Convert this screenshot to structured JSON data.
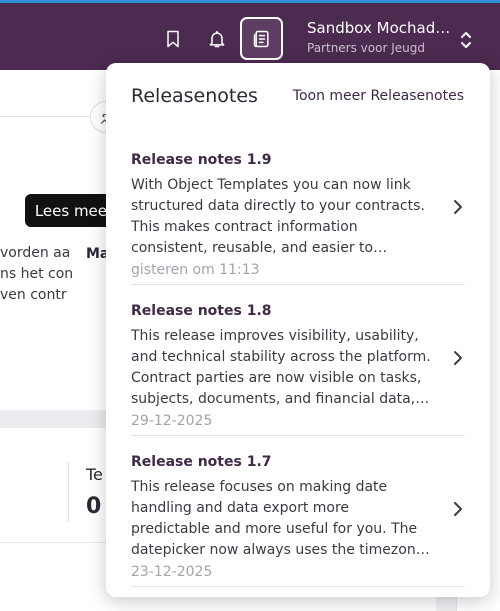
{
  "topbar": {
    "account_name": "Sandbox Mochadocs",
    "account_org": "Partners voor Jeugd"
  },
  "background": {
    "lines": [
      "vorden aa",
      "ns het con",
      "ven contr"
    ],
    "ma": "Ma",
    "te": "Te",
    "zero": "0"
  },
  "tooltip": {
    "text": "Lees meer"
  },
  "releases": {
    "title": "Releasenotes",
    "more_link": "Toon meer Releasenotes",
    "items": [
      {
        "title": "Release notes 1.9",
        "body": "With Object Templates you can now link structured data directly to your contracts. This makes contract information consistent, reusable, and easier to manage across the platform.",
        "date": "gisteren om 11:13"
      },
      {
        "title": "Release notes 1.8",
        "body": "This release improves visibility, usability, and technical stability across the platform. Contract parties are now visible on tasks, subjects, documents, and financial data, so you always know who is involved.",
        "date": "29-12-2025"
      },
      {
        "title": "Release notes 1.7",
        "body": "This release focuses on making date handling and data export more predictable and more useful for you. The datepicker now always uses the timezone of the organisation.",
        "date": "23-12-2025"
      }
    ]
  }
}
